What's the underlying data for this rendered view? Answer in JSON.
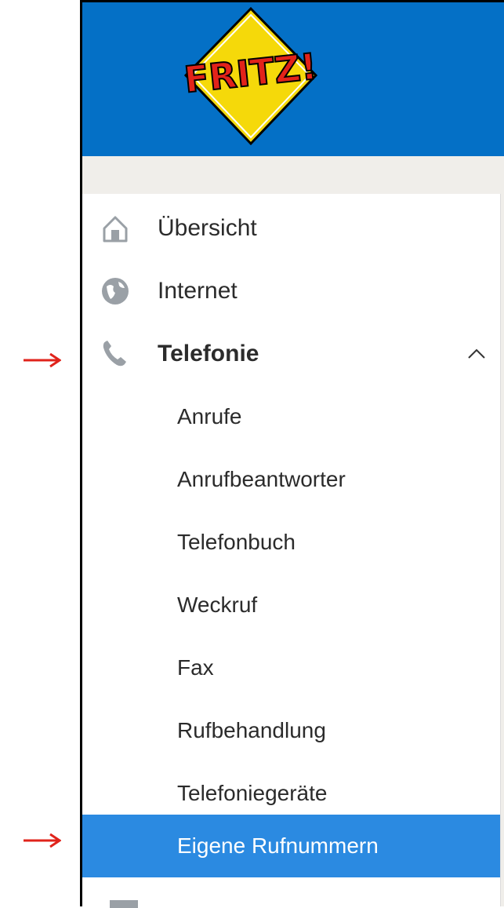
{
  "logo": {
    "text": "FRITZ!"
  },
  "nav": {
    "items": [
      {
        "label": "Übersicht",
        "icon": "home-icon"
      },
      {
        "label": "Internet",
        "icon": "globe-icon"
      },
      {
        "label": "Telefonie",
        "icon": "phone-icon",
        "expanded": true
      }
    ],
    "telefonie_sub": [
      {
        "label": "Anrufe"
      },
      {
        "label": "Anrufbeantworter"
      },
      {
        "label": "Telefonbuch"
      },
      {
        "label": "Weckruf"
      },
      {
        "label": "Fax"
      },
      {
        "label": "Rufbehandlung"
      },
      {
        "label": "Telefoniegeräte"
      },
      {
        "label": "Eigene Rufnummern",
        "active": true
      }
    ]
  },
  "colors": {
    "header": "#0470c6",
    "active": "#2b8ae1",
    "annotation_arrow": "#e0231b"
  }
}
